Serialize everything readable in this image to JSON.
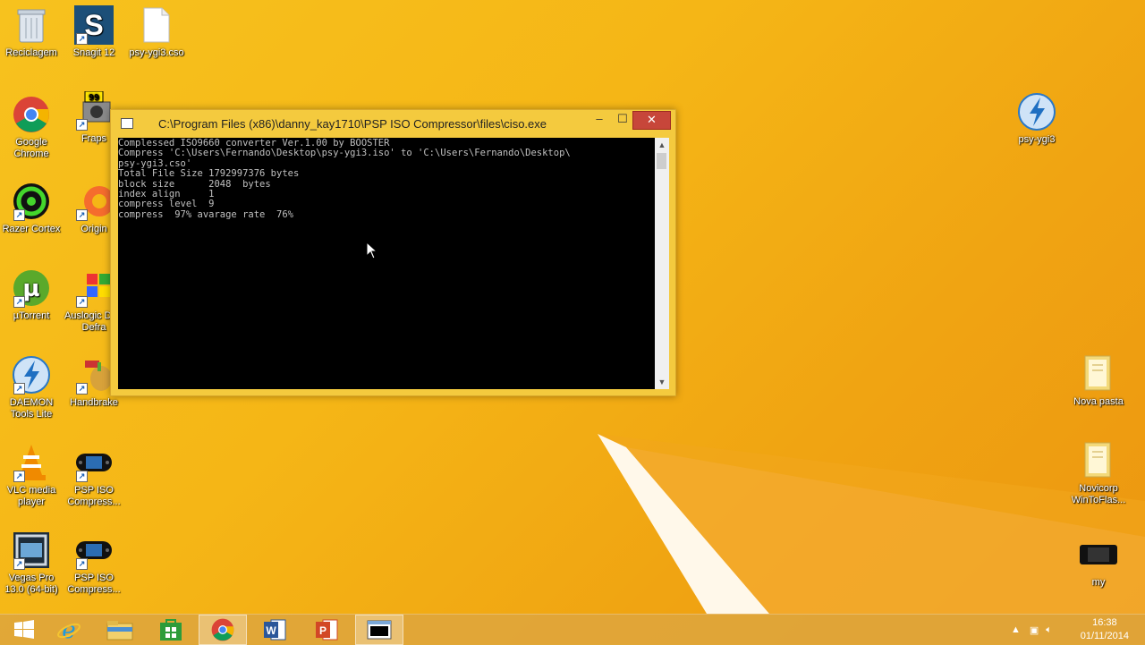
{
  "desktop": {
    "icons_left": [
      {
        "id": "recycle-bin-icon",
        "label": "Reciclagem"
      },
      {
        "id": "snagit-icon",
        "label": "Snagit 12"
      },
      {
        "id": "file-icon",
        "label": "psy-ygi3.cso"
      },
      {
        "id": "chrome-icon",
        "label": "Google Chrome"
      },
      {
        "id": "fraps-icon",
        "label": "Fraps"
      },
      {
        "id": "razer-cortex-icon",
        "label": "Razer Cortex"
      },
      {
        "id": "origin-icon",
        "label": "Origin"
      },
      {
        "id": "utorrent-icon",
        "label": "µTorrent"
      },
      {
        "id": "auslogics-icon",
        "label": "Auslogic Disk Defra"
      },
      {
        "id": "daemon-tools-icon",
        "label": "DAEMON Tools Lite"
      },
      {
        "id": "handbrake-icon",
        "label": "Handbrake"
      },
      {
        "id": "vlc-icon",
        "label": "VLC media player"
      },
      {
        "id": "psp-iso-icon",
        "label": "PSP ISO Compress..."
      },
      {
        "id": "vegas-pro-icon",
        "label": "Vegas Pro 13.0 (64-bit)"
      },
      {
        "id": "psp-iso-icon-2",
        "label": "PSP ISO Compress..."
      }
    ],
    "icons_right": [
      {
        "id": "daemon-image-icon",
        "label": "psy-ygi3"
      },
      {
        "id": "folder-icon",
        "label": "Nova pasta"
      },
      {
        "id": "folder-icon-2",
        "label": "Novicorp WinToFlas..."
      },
      {
        "id": "psp-icon",
        "label": "my"
      }
    ]
  },
  "console_window": {
    "title": "C:\\Program Files (x86)\\danny_kay1710\\PSP ISO Compressor\\files\\ciso.exe",
    "minimize": "–",
    "maximize": "☐",
    "close": "✕",
    "lines": [
      "Complessed ISO9660 converter Ver.1.00 by BOOSTER",
      "Compress 'C:\\Users\\Fernando\\Desktop\\psy-ygi3.iso' to 'C:\\Users\\Fernando\\Desktop\\",
      "psy-ygi3.cso'",
      "Total File Size 1792997376 bytes",
      "block size      2048  bytes",
      "index align     1",
      "compress level  9",
      "compress  97% avarage rate  76%"
    ],
    "colors": {
      "background": "#000000",
      "text": "#c0c0c0",
      "frame": "#f4ca3e",
      "close": "#c7463a"
    }
  },
  "taskbar": {
    "items": [
      {
        "name": "start-button",
        "label": "Start"
      },
      {
        "name": "internet-explorer-icon",
        "label": "Internet Explorer"
      },
      {
        "name": "file-explorer-icon",
        "label": "File Explorer"
      },
      {
        "name": "store-icon",
        "label": "Store"
      },
      {
        "name": "chrome-taskbar-icon",
        "label": "Google Chrome"
      },
      {
        "name": "word-icon",
        "label": "Word"
      },
      {
        "name": "powerpoint-icon",
        "label": "PowerPoint"
      },
      {
        "name": "console-taskbar-icon",
        "label": "ciso.exe"
      }
    ],
    "time": "16:38",
    "date": "01/11/2014"
  }
}
